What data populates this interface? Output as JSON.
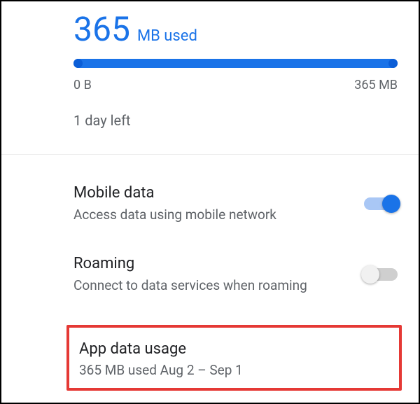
{
  "usage": {
    "value": "365",
    "unit": "MB used",
    "scale_min": "0 B",
    "scale_max": "365 MB",
    "days_left": "1 day left"
  },
  "mobile_data": {
    "title": "Mobile data",
    "subtitle": "Access data using mobile network",
    "enabled": true
  },
  "roaming": {
    "title": "Roaming",
    "subtitle": "Connect to data services when roaming",
    "enabled": false
  },
  "app_data_usage": {
    "title": "App data usage",
    "subtitle": "365 MB used Aug 2 – Sep 1"
  }
}
